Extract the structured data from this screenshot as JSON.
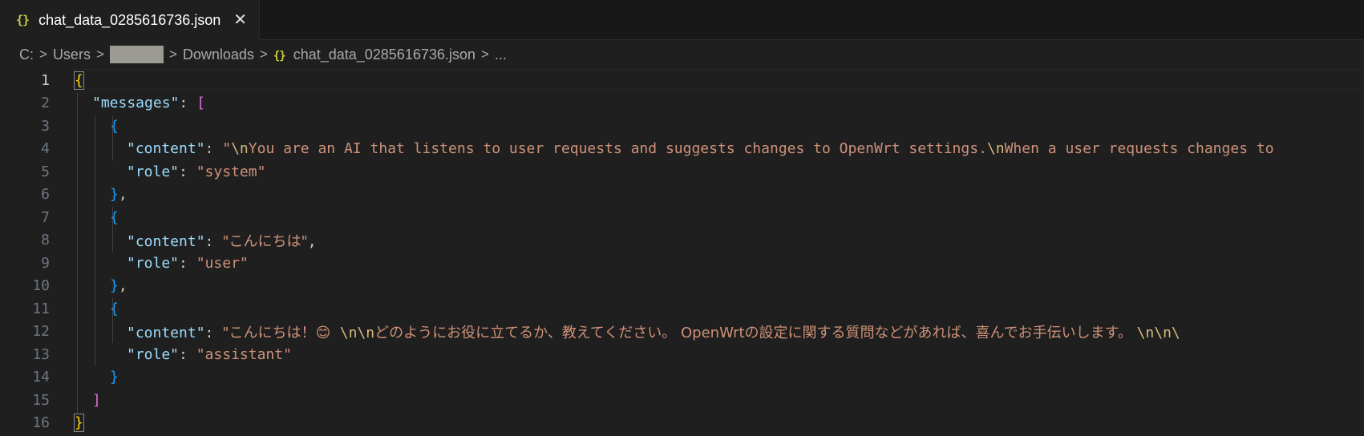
{
  "tab": {
    "label": "chat_data_0285616736.json",
    "icon": "json-icon",
    "close": "✕"
  },
  "breadcrumb": {
    "drive": "C:",
    "users": "Users",
    "downloads": "Downloads",
    "file": "chat_data_0285616736.json",
    "more": "..."
  },
  "editor": {
    "line_numbers": [
      "1",
      "2",
      "3",
      "4",
      "5",
      "6",
      "7",
      "8",
      "9",
      "10",
      "11",
      "12",
      "13",
      "14",
      "15",
      "16"
    ],
    "active_line": "1",
    "lines": {
      "l1_open": "{",
      "l2_key": "\"messages\"",
      "l2_colon": ": ",
      "l2_bracket": "[",
      "l3_open": "{",
      "l4_key": "\"content\"",
      "l4_colon": ": ",
      "l4_q": "\"",
      "l4_esc1": "\\n",
      "l4_text1": "You are an AI that listens to user requests and suggests changes to OpenWrt settings.",
      "l4_esc2": "\\n",
      "l4_text2": "When a user requests changes to",
      "l5_key": "\"role\"",
      "l5_colon": ": ",
      "l5_val": "\"system\"",
      "l6_close": "}",
      "l6_comma": ",",
      "l7_open": "{",
      "l8_key": "\"content\"",
      "l8_colon": ": ",
      "l8_val": "\"こんにちは\"",
      "l8_comma": ",",
      "l9_key": "\"role\"",
      "l9_colon": ": ",
      "l9_val": "\"user\"",
      "l10_close": "}",
      "l10_comma": ",",
      "l11_open": "{",
      "l12_key": "\"content\"",
      "l12_colon": ": ",
      "l12_text1": "\"こんにちは！😊  ",
      "l12_esc1": "\\n\\n",
      "l12_text2": "どのようにお役に立てるか、教えてください。 OpenWrtの設定に関する質問などがあれば、喜んでお手伝いします。 ",
      "l12_esc2": "\\n\\n\\",
      "l13_key": "\"role\"",
      "l13_colon": ": ",
      "l13_val": "\"assistant\"",
      "l14_close": "}",
      "l15_close": "]",
      "l16_close": "}"
    }
  }
}
